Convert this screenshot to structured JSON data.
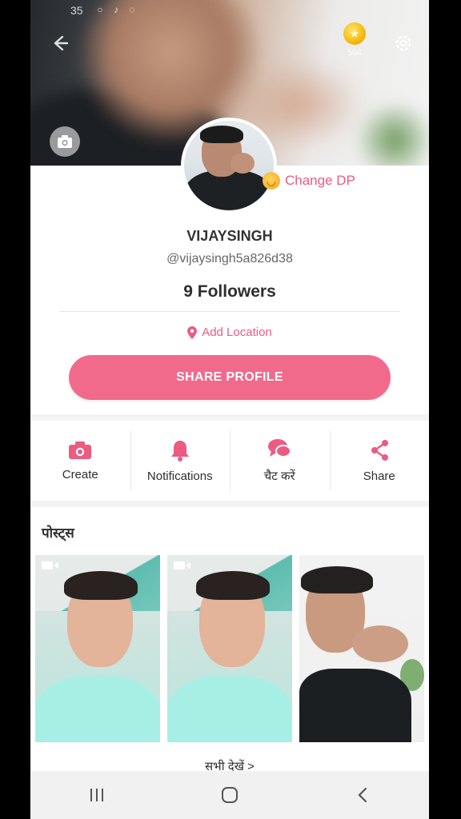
{
  "status_bar": {
    "time": "35"
  },
  "header": {
    "coin_count": "564"
  },
  "profile": {
    "change_dp_label": "Change DP",
    "display_name": "VIJAYSINGH",
    "username": "@vijaysingh5a826d38",
    "followers": "9 Followers",
    "add_location_label": "Add Location",
    "share_profile_label": "SHARE PROFILE"
  },
  "actions": [
    {
      "label": "Create",
      "icon": "camera-icon"
    },
    {
      "label": "Notifications",
      "icon": "bell-icon"
    },
    {
      "label": "चैट करें",
      "icon": "chat-icon"
    },
    {
      "label": "Share",
      "icon": "share-icon"
    }
  ],
  "posts": {
    "title": "पोस्ट्स",
    "see_all_label": "सभी देखें >"
  },
  "colors": {
    "accent": "#f16a8c",
    "accent_text": "#ec5b81"
  }
}
